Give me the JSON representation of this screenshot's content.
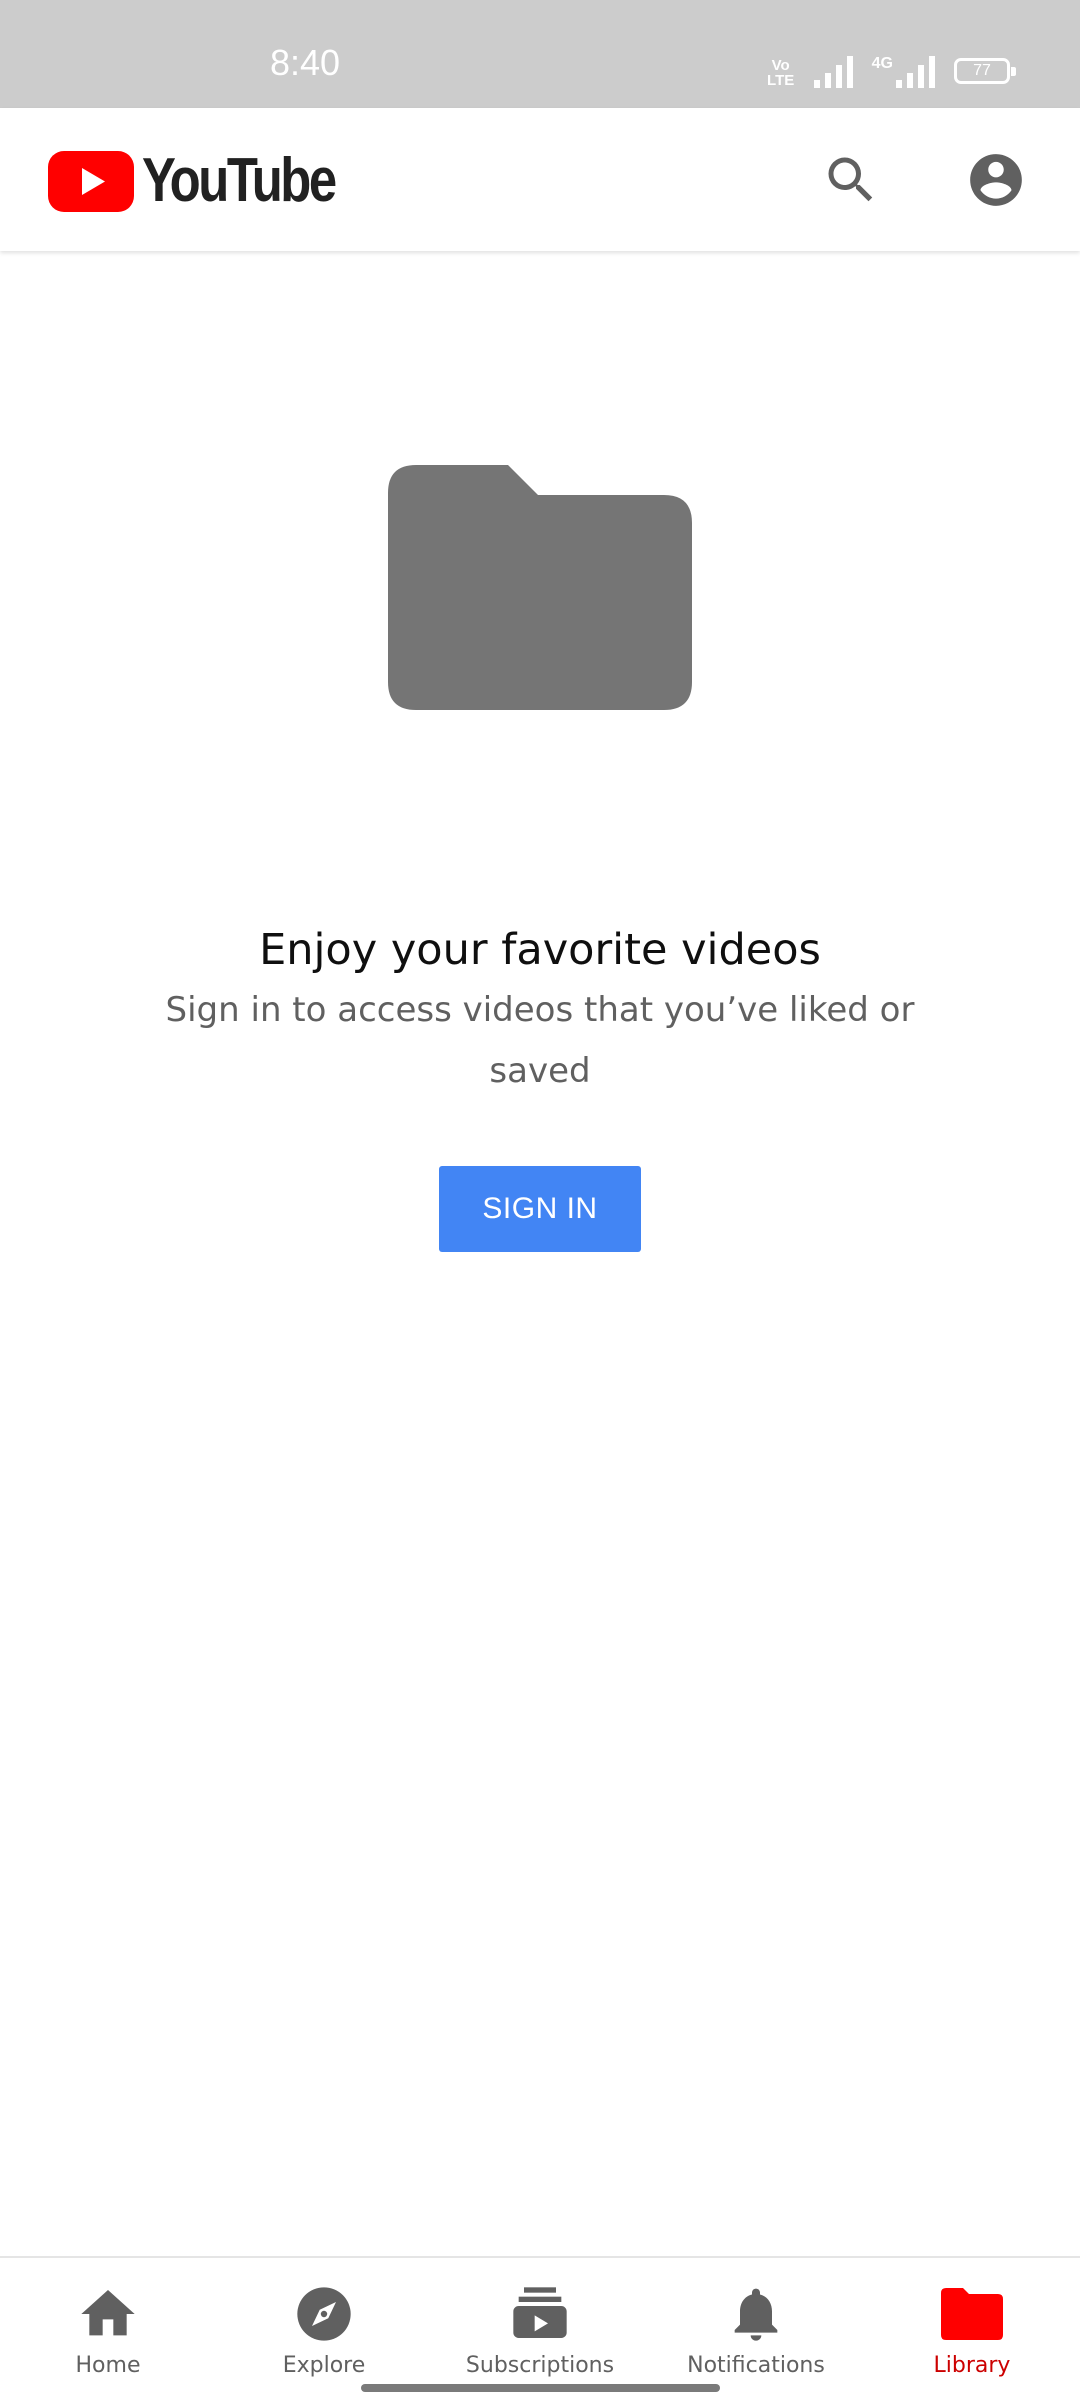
{
  "status_bar": {
    "time": "8:40",
    "volte_label": "Vo LTE",
    "network_label": "4G",
    "battery_level": "77"
  },
  "header": {
    "logo_text": "YouTube",
    "icons": {
      "search": "search-icon",
      "account": "account-circle-icon"
    }
  },
  "empty_state": {
    "illustration": "folder-icon",
    "title": "Enjoy your favorite videos",
    "subtitle": "Sign in to access videos that you’ve liked or saved",
    "signin_label": "SIGN IN"
  },
  "bottom_nav": {
    "items": [
      {
        "label": "Home",
        "icon": "home-icon",
        "active": false
      },
      {
        "label": "Explore",
        "icon": "compass-icon",
        "active": false
      },
      {
        "label": "Subscriptions",
        "icon": "subscriptions-icon",
        "active": false
      },
      {
        "label": "Notifications",
        "icon": "bell-icon",
        "active": false
      },
      {
        "label": "Library",
        "icon": "library-folder-icon",
        "active": true
      }
    ]
  },
  "colors": {
    "status_bar_bg": "#cccccc",
    "brand_red": "#ff0000",
    "active_nav": "#cc0000",
    "signin_button": "#4285f4",
    "icon_gray": "#606060",
    "illustration_gray": "#757575"
  }
}
